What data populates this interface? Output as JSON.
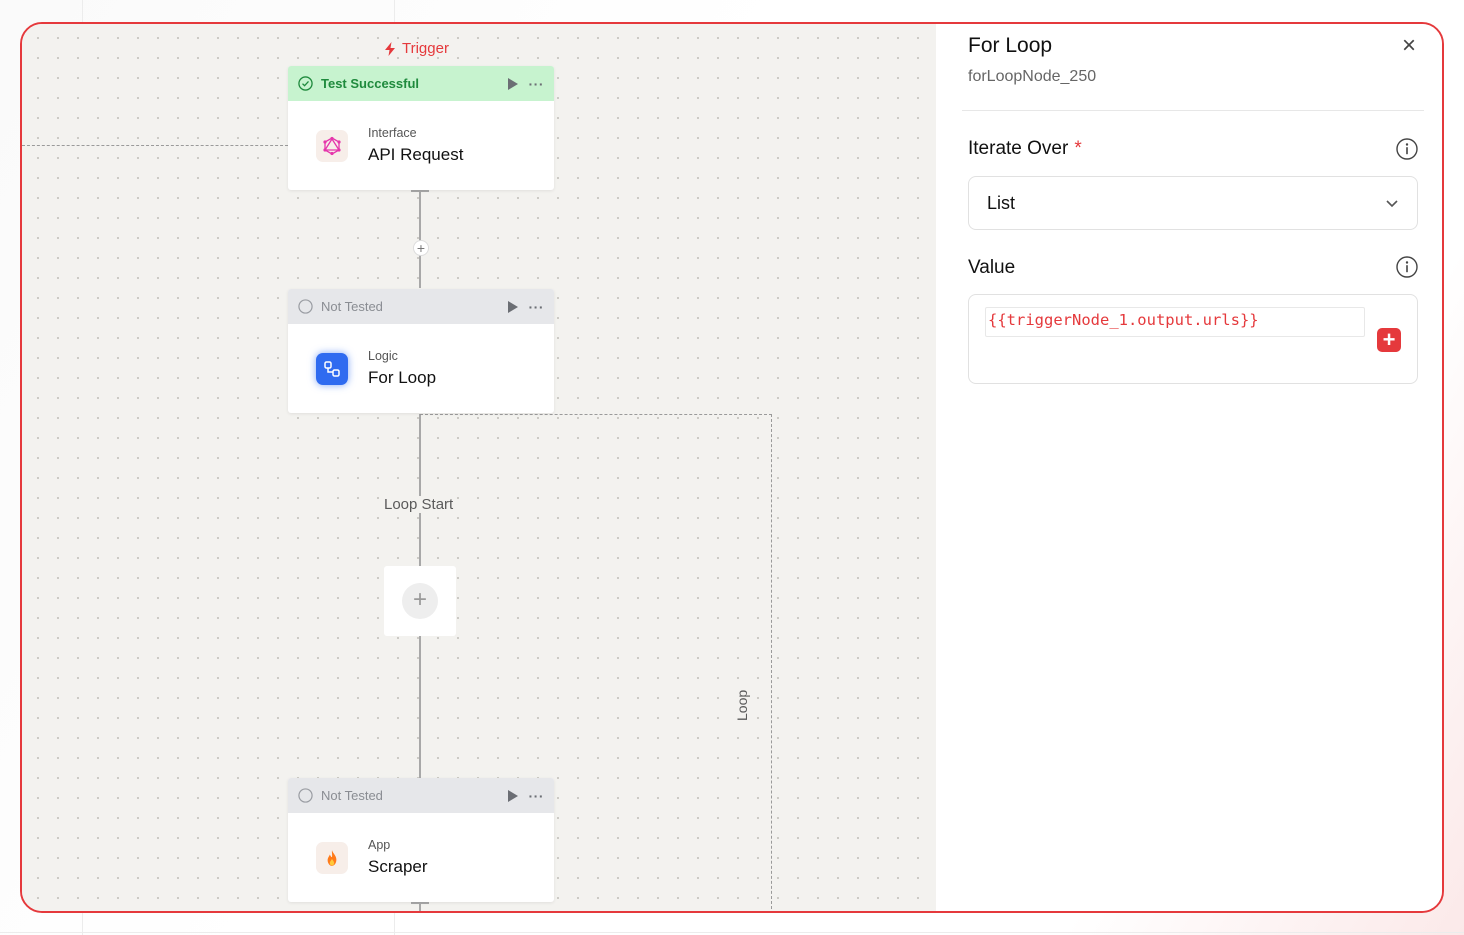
{
  "canvas": {
    "trigger_label": "Trigger",
    "loop_start_label": "Loop Start",
    "loop_label": "Loop",
    "nodes": [
      {
        "status": "Test Successful",
        "kind": "Interface",
        "name": "API Request",
        "icon": "graphql-icon"
      },
      {
        "status": "Not Tested",
        "kind": "Logic",
        "name": "For Loop",
        "icon": "loop-icon"
      },
      {
        "status": "Not Tested",
        "kind": "App",
        "name": "Scraper",
        "icon": "fire-icon"
      }
    ],
    "more_glyph": "···",
    "add_glyph": "+"
  },
  "panel": {
    "title": "For Loop",
    "node_id": "forLoopNode_250",
    "close_glyph": "×",
    "iterate_over": {
      "label": "Iterate Over",
      "required_mark": "*",
      "selected": "List"
    },
    "value": {
      "label": "Value",
      "input_value": "{{triggerNode_1.output.urls}}",
      "add_glyph": "+"
    }
  },
  "colors": {
    "accent": "#e5393c",
    "success_bg": "#c7f3cf",
    "success_text": "#1f8a3d",
    "untested_bg": "#e6e7ea",
    "logic_blue": "#2f6bf0"
  }
}
